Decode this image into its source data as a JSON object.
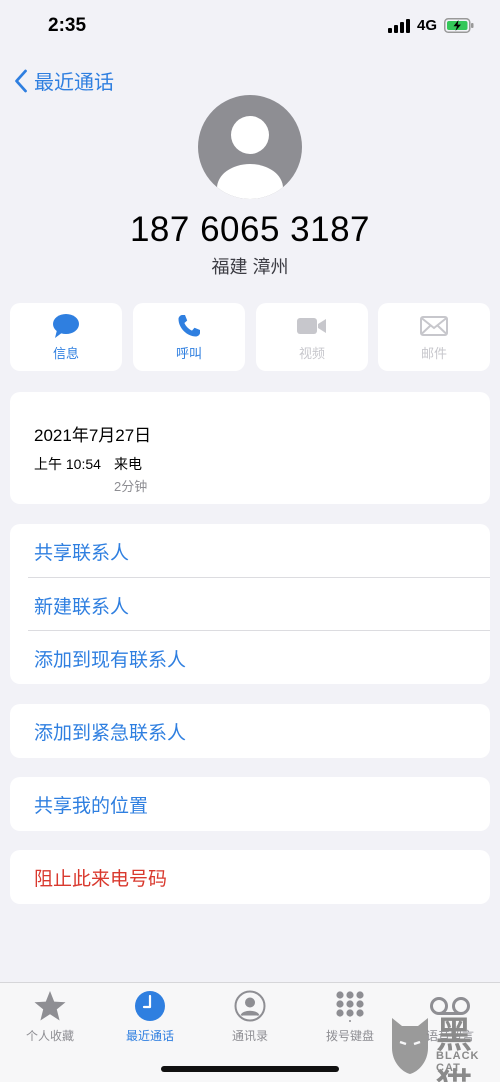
{
  "status_bar": {
    "time": "2:35",
    "network": "4G"
  },
  "nav": {
    "back_label": "最近通话",
    "back_icon": "chevron-left-icon"
  },
  "contact": {
    "number": "187 6065 3187",
    "location": "福建 漳州"
  },
  "actions": [
    {
      "label": "信息",
      "icon": "message-icon",
      "enabled": true
    },
    {
      "label": "呼叫",
      "icon": "phone-icon",
      "enabled": true
    },
    {
      "label": "视频",
      "icon": "video-icon",
      "enabled": false
    },
    {
      "label": "邮件",
      "icon": "mail-icon",
      "enabled": false
    }
  ],
  "call_log": {
    "date": "2021年7月27日",
    "time": "上午 10:54",
    "type": "来电",
    "duration": "2分钟"
  },
  "options": {
    "share_contact": "共享联系人",
    "new_contact": "新建联系人",
    "add_existing": "添加到现有联系人",
    "add_emergency": "添加到紧急联系人",
    "share_location": "共享我的位置",
    "block_caller": "阻止此来电号码"
  },
  "tabs": [
    {
      "label": "个人收藏",
      "icon": "star-icon",
      "active": false
    },
    {
      "label": "最近通话",
      "icon": "clock-icon",
      "active": true
    },
    {
      "label": "通讯录",
      "icon": "contacts-icon",
      "active": false
    },
    {
      "label": "拨号键盘",
      "icon": "keypad-icon",
      "active": false
    },
    {
      "label": "语音留言",
      "icon": "voicemail-icon",
      "active": false
    }
  ],
  "watermark": {
    "text": "黑猫",
    "sub": "BLACK CAT"
  },
  "colors": {
    "accent": "#2f7fe0",
    "destructive": "#d9392e",
    "background": "#f2f2f7",
    "battery": "#34c759"
  }
}
